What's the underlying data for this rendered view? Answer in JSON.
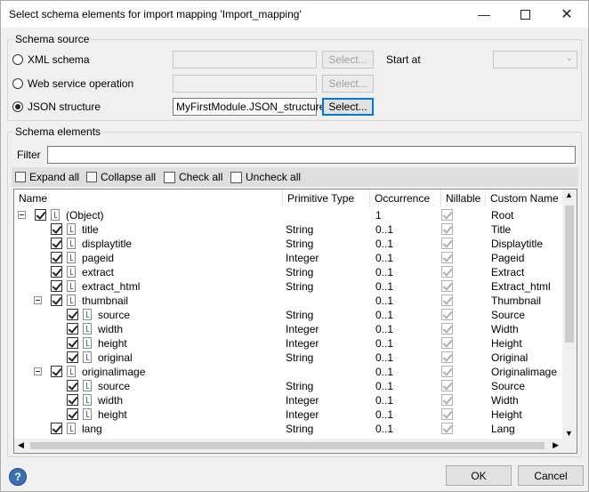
{
  "window": {
    "title": "Select schema elements for import mapping 'Import_mapping'"
  },
  "schema_source": {
    "legend": "Schema source",
    "xml_schema": {
      "label": "XML schema",
      "value": "",
      "button": "Select..."
    },
    "start_at": {
      "label": "Start at",
      "value": ""
    },
    "web_service": {
      "label": "Web service operation",
      "value": "",
      "button": "Select..."
    },
    "json": {
      "label": "JSON structure",
      "value": "MyFirstModule.JSON_structure",
      "button": "Select..."
    },
    "selected": "JSON structure"
  },
  "schema_elements": {
    "legend": "Schema elements",
    "filter_label": "Filter",
    "filter_value": "",
    "toolbar": {
      "expand_all": "Expand all",
      "collapse_all": "Collapse all",
      "check_all": "Check all",
      "uncheck_all": "Uncheck all"
    },
    "columns": [
      "Name",
      "Primitive Type",
      "Occurrence",
      "Nillable",
      "Custom Name"
    ],
    "rows": [
      {
        "name": "(Object)",
        "type": "",
        "occurrence": "1",
        "custom": "Root"
      },
      {
        "name": "title",
        "type": "String",
        "occurrence": "0..1",
        "custom": "Title"
      },
      {
        "name": "displaytitle",
        "type": "String",
        "occurrence": "0..1",
        "custom": "Displaytitle"
      },
      {
        "name": "pageid",
        "type": "Integer",
        "occurrence": "0..1",
        "custom": "Pageid"
      },
      {
        "name": "extract",
        "type": "String",
        "occurrence": "0..1",
        "custom": "Extract"
      },
      {
        "name": "extract_html",
        "type": "String",
        "occurrence": "0..1",
        "custom": "Extract_html"
      },
      {
        "name": "thumbnail",
        "type": "",
        "occurrence": "0..1",
        "custom": "Thumbnail"
      },
      {
        "name": "source",
        "type": "String",
        "occurrence": "0..1",
        "custom": "Source"
      },
      {
        "name": "width",
        "type": "Integer",
        "occurrence": "0..1",
        "custom": "Width"
      },
      {
        "name": "height",
        "type": "Integer",
        "occurrence": "0..1",
        "custom": "Height"
      },
      {
        "name": "original",
        "type": "String",
        "occurrence": "0..1",
        "custom": "Original"
      },
      {
        "name": "originalimage",
        "type": "",
        "occurrence": "0..1",
        "custom": "Originalimage"
      },
      {
        "name": "source",
        "type": "String",
        "occurrence": "0..1",
        "custom": "Source"
      },
      {
        "name": "width",
        "type": "Integer",
        "occurrence": "0..1",
        "custom": "Width"
      },
      {
        "name": "height",
        "type": "Integer",
        "occurrence": "0..1",
        "custom": "Height"
      },
      {
        "name": "lang",
        "type": "String",
        "occurrence": "0..1",
        "custom": "Lang"
      }
    ]
  },
  "footer": {
    "ok": "OK",
    "cancel": "Cancel"
  },
  "colors": {
    "focus": "#0078d7",
    "toolbar": "#dedede"
  }
}
